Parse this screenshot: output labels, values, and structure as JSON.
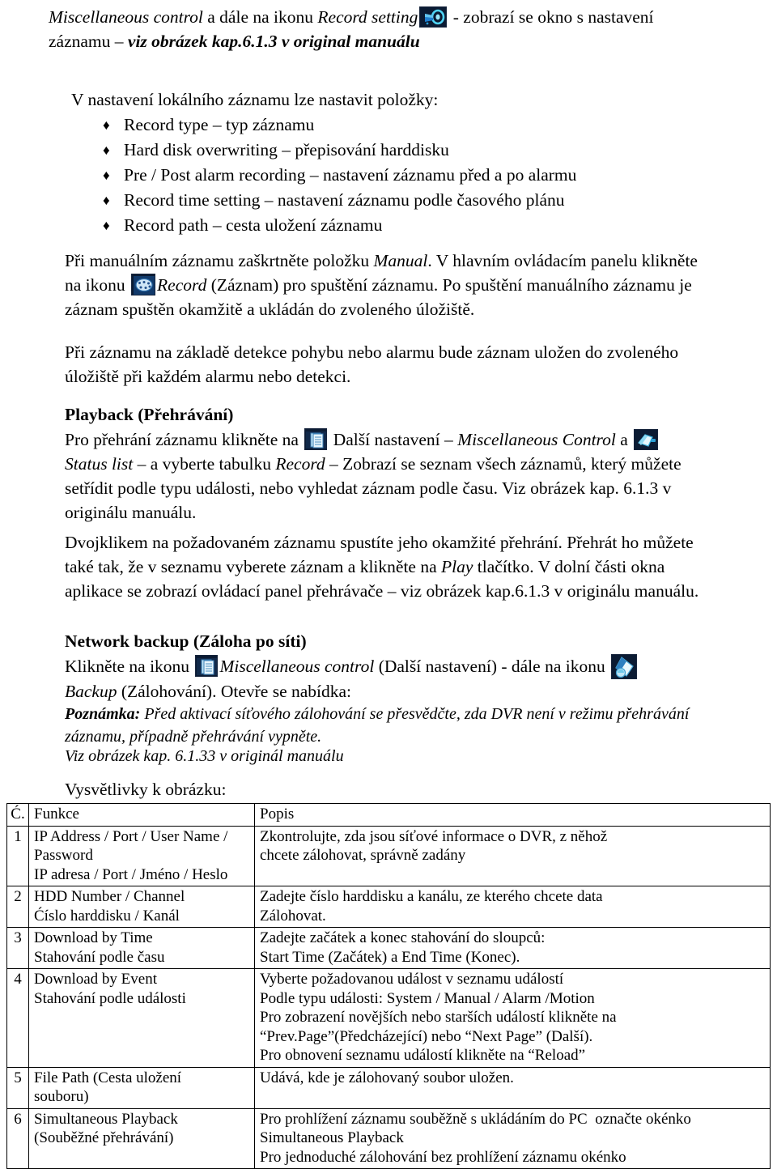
{
  "document": {
    "language": "cs",
    "intro": {
      "line1_part1": "Miscellaneous control",
      "line1_part2": " a dále na ikonu ",
      "line1_part3": "Record setting",
      "icon_record_setting": "record-setting-icon",
      "line1_part4": " - zobrazí se okno s nastavení",
      "line2_part1": "záznamu – ",
      "line2_part2": "viz obrázek kap.6.1.3 v original manuálu"
    },
    "list": {
      "intro": "V nastavení lokálního záznamu lze nastavit položky:",
      "bullet_glyph": "♦",
      "items": [
        "Record type – typ záznamu",
        "Hard disk overwriting – přepisování harddisku",
        "Pre / Post alarm recording – nastavení záznamu před a po alarmu",
        "Record time setting – nastavení záznamu podle časového plánu",
        "Record path – cesta uložení záznamu"
      ]
    },
    "manual_record": {
      "l1_a": "Při  manuálním záznamu zaškrtněte položku ",
      "l1_b": "Manual",
      "l1_c": ". V hlavním ovládacím panelu klikněte",
      "l2_a": "na ikonu ",
      "icon_record": "record-icon",
      "l2_b": "Record",
      "l2_c": " (Záznam) pro spuštění záznamu. Po spuštění manuálního záznamu je",
      "l3": "záznam spuštěn okamžitě a ukládán do zvoleného úložiště."
    },
    "motion_record": {
      "l1": "Při záznamu na základě detekce pohybu nebo alarmu bude záznam uložen do zvoleného",
      "l2": "úložiště při každém alarmu nebo detekci."
    },
    "playback": {
      "heading": "Playback  (Přehrávání)",
      "l1_a": "Pro přehrání záznamu klikněte na ",
      "icon_misc": "miscellaneous-control-icon",
      "l1_b": " Další nastavení – ",
      "l1_c": "Miscellaneous Control",
      "l1_d": " a ",
      "icon_status": "status-list-icon",
      "l2_a": "Status list",
      "l2_b": " – a vyberte tabulku ",
      "l2_c": "Record",
      "l2_d": " – Zobrazí se seznam všech záznamů, který můžete",
      "l3": "setřídit podle typu události, nebo vyhledat záznam podle času. Viz obrázek kap. 6.1.3 v",
      "l4": "originálu manuálu.",
      "p2_l1_a": "Dvojklikem na požadovaném záznamu spustíte jeho okamžité přehrání. Přehrát ho můžete",
      "p2_l2_a": "také tak, že v seznamu vyberete záznam a klikněte na ",
      "p2_l2_b": "Play",
      "p2_l2_c": " tlačítko. V dolní části okna",
      "p2_l3": "aplikace se zobrazí ovládací panel přehrávače – viz obrázek kap.6.1.3 v originálu manuálu."
    },
    "network_backup": {
      "heading": "Network backup (Záloha po síti)",
      "l1_a": "Klikněte na ikonu ",
      "icon_misc": "miscellaneous-control-icon",
      "l1_b": "Miscellaneous control",
      "l1_c": " (Další nastavení) - dále na ikonu ",
      "icon_backup": "backup-icon",
      "l2_a": "Backup",
      "l2_b": "  (Zálohování).  Otevře se nabídka:",
      "note_label": "Poznámka:",
      "note_l1": " Před aktivací síťového zálohování se přesvědčte, zda DVR není v režimu přehrávání",
      "note_l2": "záznamu, případně přehrávání vypněte.",
      "ref": "Viz obrázek kap. 6.1.33 v originál manuálu"
    },
    "legend": {
      "caption": "Vysvětlivky k obrázku:",
      "columns": [
        "Ć.",
        "Funkce",
        "Popis"
      ],
      "rows": [
        {
          "num": "1",
          "func": [
            "IP Address / Port / User Name /",
            "Password",
            "IP adresa / Port / Jméno / Heslo"
          ],
          "desc": [
            "Zkontrolujte, zda jsou síťové informace o DVR, z něhož",
            "chcete zálohovat, správně zadány"
          ]
        },
        {
          "num": "2",
          "func": [
            "HDD Number / Channel",
            "Ćíslo harddisku / Kanál"
          ],
          "desc": [
            "Zadejte číslo harddisku a kanálu, ze kterého chcete data",
            "Zálohovat."
          ]
        },
        {
          "num": "3",
          "func": [
            "Download by Time",
            "Stahování podle času"
          ],
          "desc": [
            "Zadejte začátek a konec stahování do sloupců:",
            "Start Time (Začátek) a End Time (Konec)."
          ]
        },
        {
          "num": "4",
          "func": [
            "Download by Event",
            "Stahování podle události"
          ],
          "desc": [
            "Vyberte požadovanou událost v seznamu událostí",
            "Podle typu události: System / Manual / Alarm /Motion",
            "Pro zobrazení novějších nebo starších událostí klikněte na",
            "“Prev.Page”(Předcházející) nebo “Next Page” (Další).",
            "Pro obnovení seznamu událostí klikněte na “Reload”"
          ]
        },
        {
          "num": "5",
          "func": [
            "File Path (Cesta uložení",
            "souboru)"
          ],
          "desc": [
            "Udává, kde je zálohovaný soubor uložen."
          ]
        },
        {
          "num": "6",
          "func": [
            "Simultaneous Playback",
            "(Souběžné přehrávání)"
          ],
          "desc": [
            "Pro prohlížení záznamu souběžně s ukládáním do PC  označte okénko",
            "Simultaneous Playback",
            "Pro jednoduché zálohování bez prohlížení záznamu okénko"
          ]
        }
      ]
    }
  },
  "colors": {
    "page_background": "#ffffff",
    "text": "#000000",
    "table_border": "#000000",
    "icon_background": "#0b1b33",
    "icon_accent_cyan": "#35c6ef",
    "icon_accent_light": "#d8eef8"
  }
}
